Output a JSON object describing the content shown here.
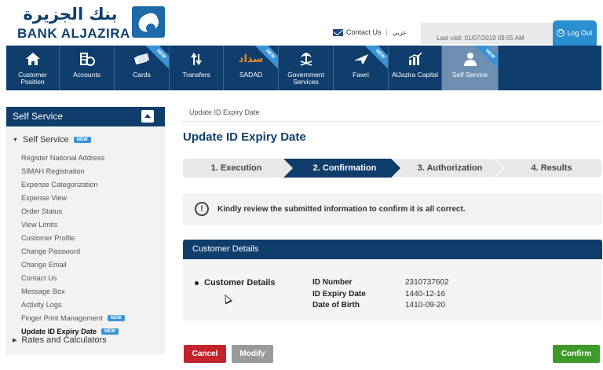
{
  "header": {
    "logo_arabic": "بنك الجزيرة",
    "logo_english": "BANK ALJAZIRA",
    "contact_label": "Contact Us",
    "arabic_link": "عربي",
    "last_visit": "Last visit: 01/07/2019 09:55 AM",
    "logout_label": "Log Out"
  },
  "nav": {
    "items": [
      {
        "label": "Customer Position",
        "icon": "house-icon",
        "new": false
      },
      {
        "label": "Accounts",
        "icon": "coins-icon",
        "new": false
      },
      {
        "label": "Cards",
        "icon": "cards-icon",
        "new": true
      },
      {
        "label": "Transfers",
        "icon": "transfer-arrows-icon",
        "new": false
      },
      {
        "label": "SADAD",
        "icon": "sadad-logo-icon",
        "new": true
      },
      {
        "label": "Government Services",
        "icon": "palm-emblem-icon",
        "new": false
      },
      {
        "label": "Fawri",
        "icon": "plane-icon",
        "new": true
      },
      {
        "label": "AlJazira Capital",
        "icon": "bar-chart-icon",
        "new": false
      },
      {
        "label": "Self Service",
        "icon": "user-icon",
        "new": true,
        "active": true
      }
    ],
    "new_badge": "NEW",
    "sadad_wordmark": "سداد"
  },
  "sidebar": {
    "title": "Self Service",
    "section": "Self Service",
    "section_badge": "NEW",
    "items": [
      {
        "label": "Register National Address"
      },
      {
        "label": "SIMAH Registration"
      },
      {
        "label": "Expense Categorization"
      },
      {
        "label": "Expense View"
      },
      {
        "label": "Order Status"
      },
      {
        "label": "View Limits"
      },
      {
        "label": "Customer Profile"
      },
      {
        "label": "Change Password"
      },
      {
        "label": "Change Email"
      },
      {
        "label": "Contact Us"
      },
      {
        "label": "Message Box"
      },
      {
        "label": "Activity Logs"
      },
      {
        "label": "Finger Print Management",
        "badge": "NEW"
      },
      {
        "label": "Update ID Expiry Date",
        "badge": "NEW",
        "current": true
      }
    ],
    "rates": "Rates and Calculators"
  },
  "main": {
    "breadcrumb": "Update ID Expiry Date",
    "title": "Update ID Expiry Date",
    "steps": [
      {
        "label": "1. Execution",
        "state": "done"
      },
      {
        "label": "2. Confirmation",
        "state": "active"
      },
      {
        "label": "3. Authorization",
        "state": "pending"
      },
      {
        "label": "4. Results",
        "state": "pending"
      }
    ],
    "notice": "Kindly review the submitted information to confirm it is all correct.",
    "panel_title": "Customer Details",
    "details_label": "Customer Details",
    "fields": [
      {
        "label": "ID Number",
        "value": "2310737602"
      },
      {
        "label": "ID Expiry Date",
        "value": "1440-12-16"
      },
      {
        "label": "Date of Birth",
        "value": "1410-09-20"
      }
    ]
  },
  "buttons": {
    "cancel": "Cancel",
    "modify": "Modify",
    "confirm": "Confirm"
  },
  "colors": {
    "navy": "#0f3d6c",
    "accent_blue": "#3a93d6",
    "cancel_red": "#c4232c",
    "confirm_green": "#3f9a2c",
    "modify_gray": "#9a9a9a"
  }
}
